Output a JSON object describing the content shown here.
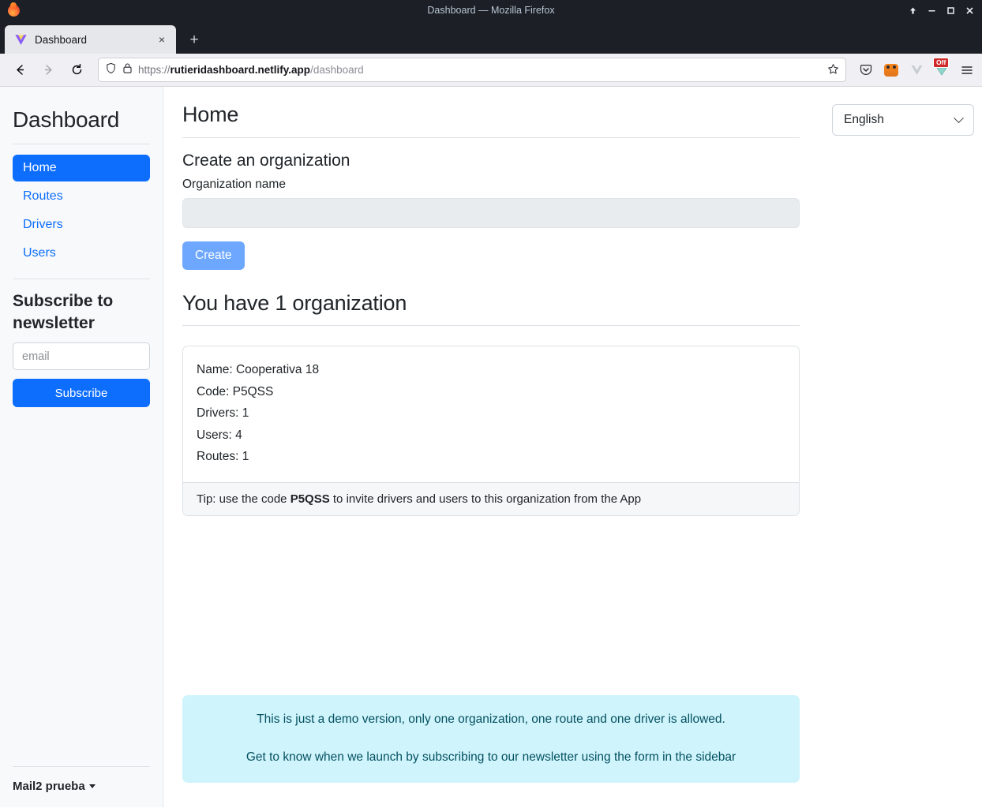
{
  "window": {
    "title": "Dashboard — Mozilla Firefox",
    "controls": {
      "restore": "restore-up",
      "minimize": "minimize",
      "maximize": "maximize",
      "close": "close"
    }
  },
  "browser": {
    "tab": {
      "label": "Dashboard",
      "favicon": "vue-logo-icon",
      "close": "×"
    },
    "new_tab": "+",
    "nav": {
      "back": "←",
      "forward": "→",
      "reload": "⟳"
    },
    "url": {
      "scheme": "https://",
      "host": "rutieridashboard.netlify.app",
      "path": "/dashboard",
      "shield_icon": "shield-icon",
      "lock_icon": "padlock-icon",
      "bookmark_icon": "star-icon"
    },
    "extensions": [
      {
        "name": "pocket-icon",
        "badge": ""
      },
      {
        "name": "metamask-icon",
        "badge": ""
      },
      {
        "name": "vue-devtools-icon",
        "badge": ""
      },
      {
        "name": "extension-toggle-icon",
        "badge": "Off"
      },
      {
        "name": "app-menu-icon",
        "badge": ""
      }
    ]
  },
  "sidebar": {
    "brand": "Dashboard",
    "nav_items": [
      {
        "label": "Home",
        "active": true
      },
      {
        "label": "Routes",
        "active": false
      },
      {
        "label": "Drivers",
        "active": false
      },
      {
        "label": "Users",
        "active": false
      }
    ],
    "newsletter": {
      "title": "Subscribe to newsletter",
      "email_placeholder": "email",
      "email_value": "",
      "button": "Subscribe"
    },
    "user": {
      "name": "Mail2 prueba",
      "caret": "caret-down-icon"
    }
  },
  "main": {
    "page_title": "Home",
    "language": {
      "selected": "English",
      "chevron": "chevron-down-icon"
    },
    "create": {
      "section_title": "Create an organization",
      "field_label": "Organization name",
      "input_value": "",
      "input_placeholder": "",
      "button": "Create",
      "button_disabled": true
    },
    "orgs": {
      "heading": "You have 1 organization",
      "card": {
        "name_line": "Name: Cooperativa 18",
        "code_line": "Code: P5QSS",
        "drivers_line": "Drivers: 1",
        "users_line": "Users: 4",
        "routes_line": "Routes: 1",
        "tip_prefix": "Tip: use the code ",
        "tip_code": "P5QSS",
        "tip_suffix": " to invite drivers and users to this organization from the App"
      }
    },
    "alert": {
      "line1": "This is just a demo version, only one organization, one route and one driver is allowed.",
      "line2": "Get to know when we launch by subscribing to our newsletter using the form in the sidebar"
    }
  },
  "colors": {
    "primary": "#0d6efd",
    "primary_disabled": "#6ea8fe",
    "sidebar_bg": "#f8f9fa",
    "alert_bg": "#cff4fc",
    "alert_text": "#055160",
    "chrome_dark": "#1c2026"
  }
}
